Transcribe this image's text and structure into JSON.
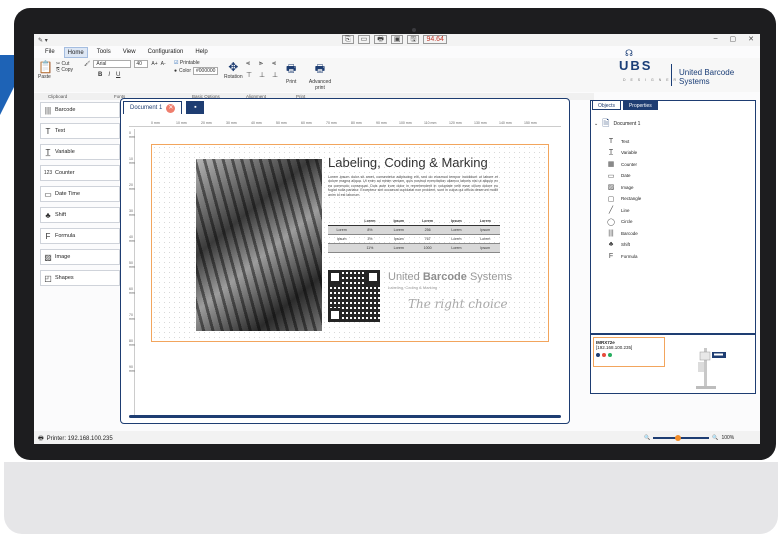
{
  "titlebar": {
    "app_icon": "✎ ▾",
    "quick_buttons": [
      "⎘",
      "▭",
      "🖶",
      "▣",
      "🖫"
    ],
    "zoom_badge": "94.64",
    "window_controls": [
      "–",
      "▢",
      "✕"
    ]
  },
  "menu": [
    "File",
    "Home",
    "Tools",
    "View",
    "Configuration",
    "Help"
  ],
  "ribbon": {
    "clipboard": {
      "paste": "Paste",
      "cut": "Cut",
      "copy": "Copy"
    },
    "font": {
      "family": "Arial",
      "size": "40",
      "grow": "A+",
      "shrink": "A-",
      "bold": "B",
      "italic": "I",
      "underline": "U"
    },
    "basic": {
      "printable": "Printable",
      "color_label": "Color",
      "color_value": "#000000",
      "rotation": "Rotation"
    },
    "print": {
      "print": "Print",
      "advanced": "Advanced print"
    },
    "group_labels": [
      "Clipboard",
      "Fonts",
      "Basic Options",
      "Alignment",
      "Print"
    ]
  },
  "brand": {
    "logo": "UBS",
    "sub": "D E S I G N E R",
    "name": "United Barcode Systems"
  },
  "tools": [
    {
      "label": "Barcode",
      "icon": "barcode-icon",
      "glyph": "|||"
    },
    {
      "label": "Text",
      "icon": "text-icon",
      "glyph": "T"
    },
    {
      "label": "Variable",
      "icon": "variable-icon",
      "glyph": "T̲"
    },
    {
      "label": "Counter",
      "icon": "counter-icon",
      "glyph": "123"
    },
    {
      "label": "Date Time",
      "icon": "datetime-icon",
      "glyph": "▭"
    },
    {
      "label": "Shift",
      "icon": "shift-icon",
      "glyph": "♣"
    },
    {
      "label": "Formula",
      "icon": "formula-icon",
      "glyph": "F"
    },
    {
      "label": "Image",
      "icon": "image-icon",
      "glyph": "▨"
    },
    {
      "label": "Shapes",
      "icon": "shapes-icon",
      "glyph": "◰"
    }
  ],
  "document": {
    "tab": "Document 1",
    "ruler_h": [
      "0 mm",
      "10 mm",
      "20 mm",
      "30 mm",
      "40 mm",
      "50 mm",
      "60 mm",
      "70 mm",
      "80 mm",
      "90 mm",
      "100 mm",
      "110 mm",
      "120 mm",
      "130 mm",
      "140 mm",
      "150 mm"
    ],
    "ruler_v": [
      "0 mm",
      "10 mm",
      "20 mm",
      "30 mm",
      "40 mm",
      "50 mm",
      "60 mm",
      "70 mm",
      "80 mm",
      "90 mm"
    ],
    "label": {
      "title": "Labeling, Coding & Marking",
      "lorem": "Lorem ipsum dolor sit amet, consectetur adipiscing elit, sed do eiusmod tempor incididunt ut labore et dolore magna aliqua. Ut enim ad minim veniam, quis nostrud exercitation ullamco laboris nisi ut aliquip ex ea commodo consequat. Duis aute irure dolor in reprehenderit in voluptate velit esse cillum dolore eu fugiat nulla pariatur. Excepteur sint occaecat cupidatat non proident, sunt in culpa qui officia deserunt mollit anim id est laborum.",
      "table_header": [
        "Lorem",
        "Ipsum",
        "Lorem",
        "Ipsum",
        "Lorem"
      ],
      "table_rows": [
        [
          "Lorem",
          "8%",
          "Lorem",
          "256",
          "Lorem",
          "Ipsum"
        ],
        [
          "Ipsum",
          "3%",
          "Ipsum",
          "767",
          "Lorem",
          "Lorem"
        ],
        [
          "",
          "11%",
          "Lorem",
          "1000",
          "Lorem",
          "Ipsum"
        ]
      ],
      "brand_light": "United ",
      "brand_bold": "Barcode",
      "brand_rest": " Systems",
      "brand_sub": "Labeling, Coding & Marking",
      "signature": "The right choice"
    }
  },
  "right_panel": {
    "tabs": [
      "Objects",
      "Properties"
    ],
    "root": "Document 1",
    "nodes": [
      {
        "label": "Text",
        "glyph": "T",
        "icon": "text-icon"
      },
      {
        "label": "Variable",
        "glyph": "T̲",
        "icon": "variable-icon"
      },
      {
        "label": "Counter",
        "glyph": "▦",
        "icon": "counter-icon"
      },
      {
        "label": "Date",
        "glyph": "▭",
        "icon": "date-icon"
      },
      {
        "label": "Image",
        "glyph": "▨",
        "icon": "image-icon"
      },
      {
        "label": "Rectangle",
        "glyph": "▢",
        "icon": "rectangle-icon"
      },
      {
        "label": "Line",
        "glyph": "╱",
        "icon": "line-icon"
      },
      {
        "label": "Circle",
        "glyph": "◯",
        "icon": "circle-icon"
      },
      {
        "label": "Barcode",
        "glyph": "|||",
        "icon": "barcode-icon"
      },
      {
        "label": "Shift",
        "glyph": "♣",
        "icon": "shift-icon"
      },
      {
        "label": "Formula",
        "glyph": "F",
        "icon": "formula-icon"
      }
    ]
  },
  "printer_card": {
    "name": "IMRX72e",
    "ip": "[192.168.100.235]"
  },
  "status": {
    "printer": "Printer: 192.168.100.235",
    "zoom": "100%"
  },
  "colors": {
    "accent": "#1e3d72",
    "label_border": "#f2a55d",
    "close": "#ef7e6d",
    "slider_knob": "#f28c28"
  }
}
